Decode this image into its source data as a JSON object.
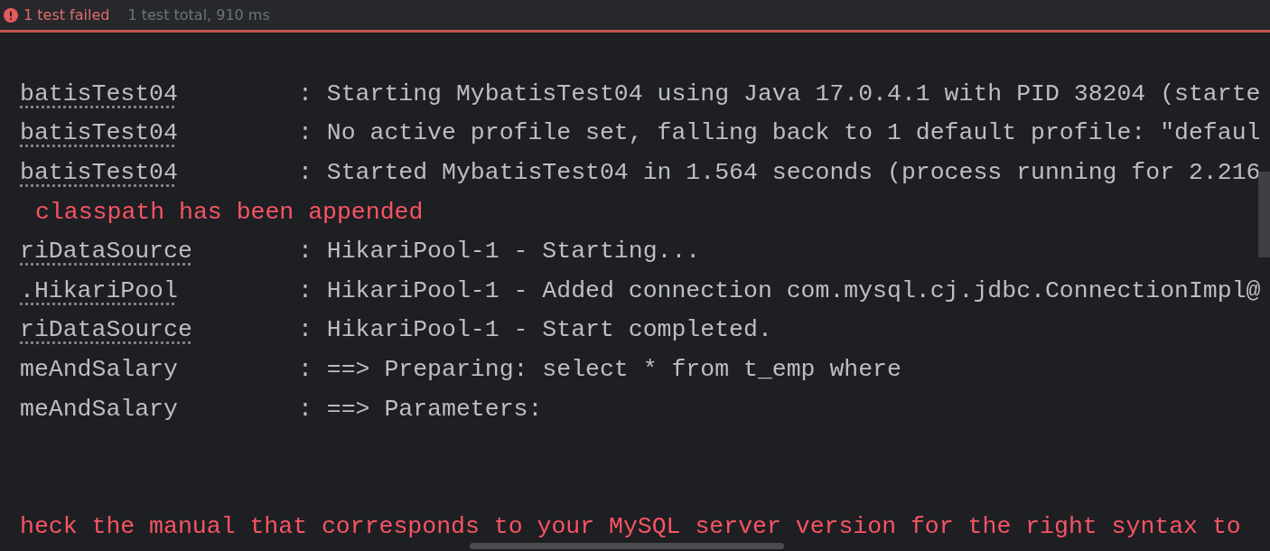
{
  "status_bar": {
    "failed": "1 test failed",
    "summary": "1 test total, 910 ms"
  },
  "console": {
    "lines": [
      {
        "kind": "log",
        "logger": "batisTest04",
        "underlined": true,
        "message": ": Starting MybatisTest04 using Java 17.0.4.1 with PID 38204 (starte"
      },
      {
        "kind": "log",
        "logger": "batisTest04",
        "underlined": true,
        "message": ": No active profile set, falling back to 1 default profile: \"defaul"
      },
      {
        "kind": "log",
        "logger": "batisTest04",
        "underlined": true,
        "message": ": Started MybatisTest04 in 1.564 seconds (process running for 2.216"
      },
      {
        "kind": "error",
        "message": "classpath has been appended"
      },
      {
        "kind": "log",
        "logger": "riDataSource",
        "underlined": true,
        "message": ": HikariPool-1 - Starting..."
      },
      {
        "kind": "log",
        "logger": ".HikariPool",
        "underlined": true,
        "message": ": HikariPool-1 - Added connection com.mysql.cj.jdbc.ConnectionImpl@"
      },
      {
        "kind": "log",
        "logger": "riDataSource",
        "underlined": true,
        "message": ": HikariPool-1 - Start completed."
      },
      {
        "kind": "log",
        "logger": "meAndSalary",
        "underlined": false,
        "message": ": ==>  Preparing: select * from t_emp where"
      },
      {
        "kind": "log",
        "logger": "meAndSalary",
        "underlined": false,
        "message": ": ==> Parameters:"
      },
      {
        "kind": "blank"
      },
      {
        "kind": "blank"
      },
      {
        "kind": "error",
        "message": "heck the manual that corresponds to your MySQL server version for the right syntax to"
      }
    ]
  }
}
